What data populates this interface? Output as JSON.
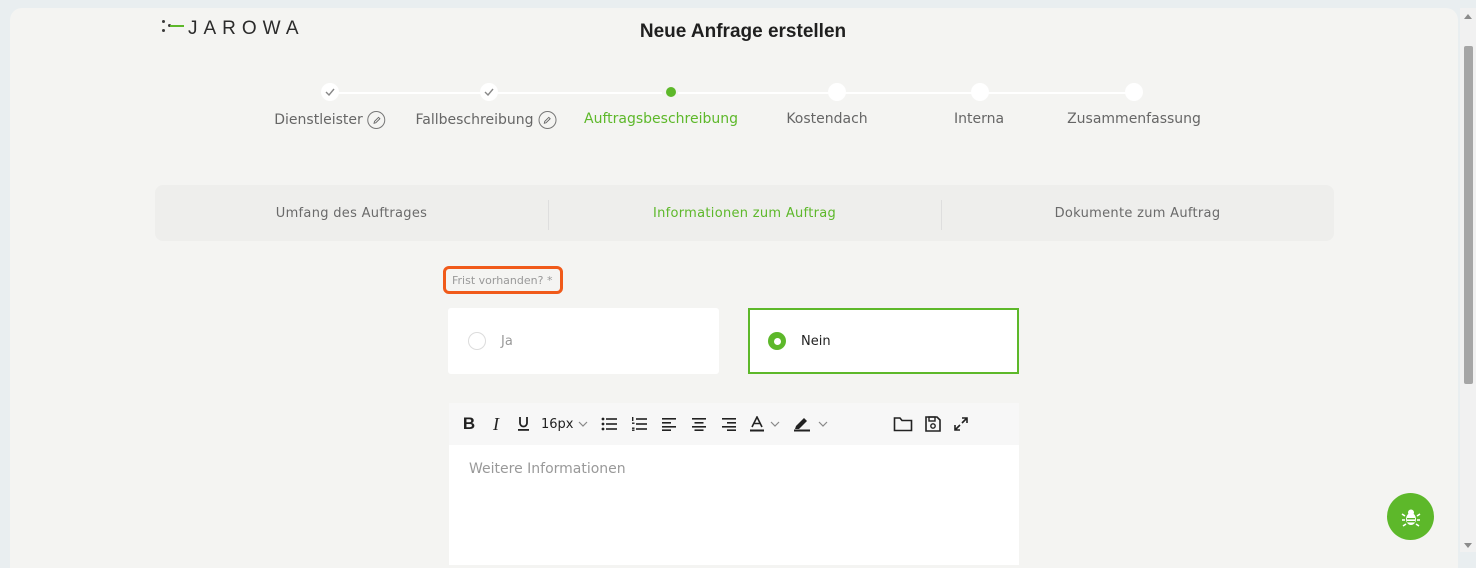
{
  "header": {
    "logo_text": "JAROWA",
    "title": "Neue Anfrage erstellen"
  },
  "stepper": {
    "steps": [
      {
        "label": "Dienstleister",
        "state": "done",
        "editable": true
      },
      {
        "label": "Fallbeschreibung",
        "state": "done",
        "editable": true
      },
      {
        "label": "Auftragsbeschreibung",
        "state": "active",
        "editable": false
      },
      {
        "label": "Kostendach",
        "state": "pending",
        "editable": false
      },
      {
        "label": "Interna",
        "state": "pending",
        "editable": false
      },
      {
        "label": "Zusammenfassung",
        "state": "pending",
        "editable": false
      }
    ]
  },
  "subtabs": [
    {
      "label": "Umfang des Auftrages",
      "active": false
    },
    {
      "label": "Informationen zum Auftrag",
      "active": true
    },
    {
      "label": "Dokumente zum Auftrag",
      "active": false
    }
  ],
  "form": {
    "deadline_label": "Frist vorhanden? *",
    "options": [
      {
        "label": "Ja",
        "selected": false
      },
      {
        "label": "Nein",
        "selected": true
      }
    ]
  },
  "editor": {
    "font_size": "16px",
    "placeholder": "Weitere Informationen"
  },
  "colors": {
    "accent": "#5db82a",
    "highlight": "#f05a1a"
  },
  "icons": [
    "check-icon",
    "edit-icon",
    "bold-icon",
    "italic-icon",
    "underline-icon",
    "bullet-list-icon",
    "numbered-list-icon",
    "align-left-icon",
    "align-center-icon",
    "align-right-icon",
    "text-color-icon",
    "highlight-color-icon",
    "folder-icon",
    "save-icon",
    "expand-icon",
    "bug-icon"
  ]
}
